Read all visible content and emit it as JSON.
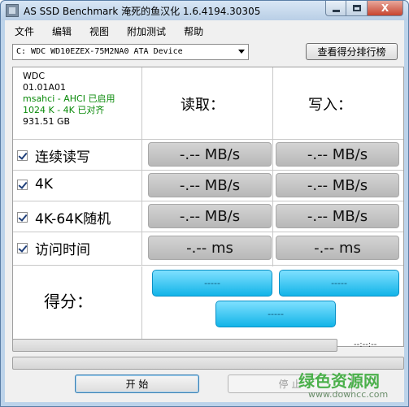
{
  "window": {
    "title": "AS SSD Benchmark 淹死的鱼汉化 1.6.4194.30305",
    "close_glyph": "X"
  },
  "menu": {
    "items": [
      "文件",
      "编辑",
      "视图",
      "附加测试",
      "帮助"
    ]
  },
  "drive": {
    "selected": "C: WDC WD10EZEX-75M2NA0 ATA Device"
  },
  "toolbar": {
    "rank_label": "查看得分排行榜"
  },
  "drive_info": {
    "name": "WDC",
    "firmware": "01.01A01",
    "driver": "msahci - AHCI 已启用",
    "alignment": "1024 K - 4K 已对齐",
    "size": "931.51 GB"
  },
  "columns": {
    "read": "读取：",
    "write": "写入："
  },
  "tests": [
    {
      "label": "连续读写",
      "checked": true,
      "read": "-.-- MB/s",
      "write": "-.-- MB/s"
    },
    {
      "label": "4K",
      "checked": true,
      "read": "-.-- MB/s",
      "write": "-.-- MB/s"
    },
    {
      "label": "4K-64K随机",
      "checked": true,
      "read": "-.-- MB/s",
      "write": "-.-- MB/s"
    },
    {
      "label": "访问时间",
      "checked": true,
      "read": "-.-- ms",
      "write": "-.-- ms"
    }
  ],
  "score": {
    "label": "得分：",
    "read": "-----",
    "write": "-----",
    "total": "-----"
  },
  "progress": {
    "time": "--:--:--",
    "value_1": 0,
    "value_2": 0
  },
  "buttons": {
    "start": "开  始",
    "stop": "停  止"
  },
  "watermark": {
    "text": "绿色资源网",
    "url": "www.downcc.com"
  },
  "colors": {
    "score_fill": "#12b4e8",
    "result_fill": "#c4c4c4",
    "info_green": "#0a8a0a"
  }
}
